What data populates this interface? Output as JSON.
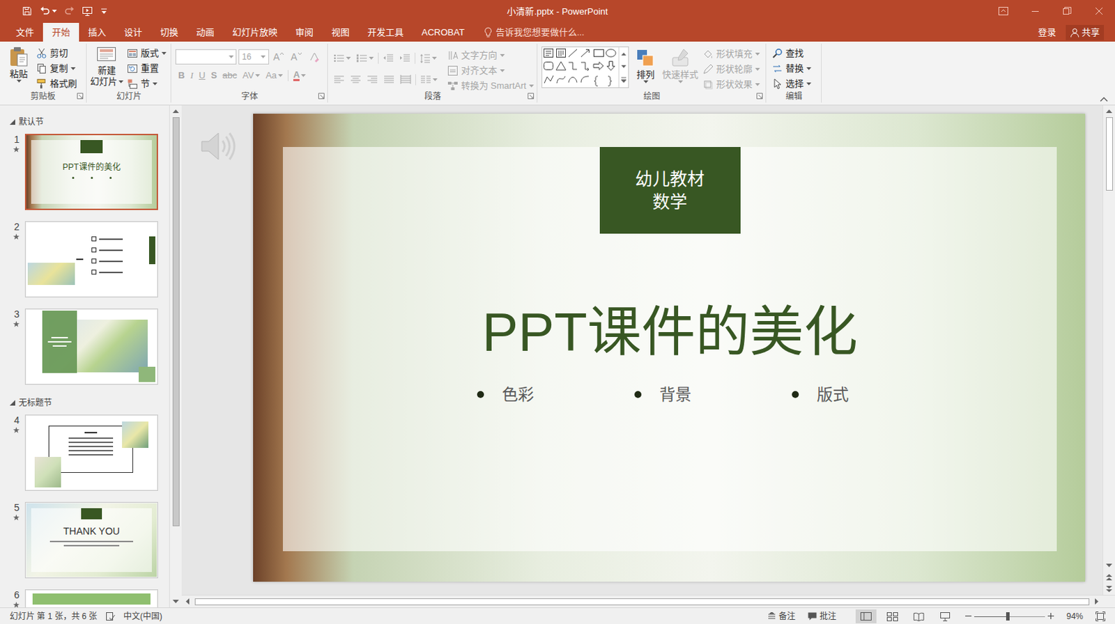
{
  "window": {
    "title": "小清新.pptx - PowerPoint"
  },
  "quick_access": [
    {
      "kind": "save",
      "disabled": false
    },
    {
      "kind": "undo",
      "disabled": false
    },
    {
      "kind": "redo",
      "disabled": true
    },
    {
      "kind": "slideshow",
      "disabled": false
    },
    {
      "kind": "customize",
      "disabled": false
    }
  ],
  "ribbon_tabs": [
    {
      "label": "文件",
      "selected": false
    },
    {
      "label": "开始",
      "selected": true
    },
    {
      "label": "插入",
      "selected": false
    },
    {
      "label": "设计",
      "selected": false
    },
    {
      "label": "切换",
      "selected": false
    },
    {
      "label": "动画",
      "selected": false
    },
    {
      "label": "幻灯片放映",
      "selected": false
    },
    {
      "label": "审阅",
      "selected": false
    },
    {
      "label": "视图",
      "selected": false
    },
    {
      "label": "开发工具",
      "selected": false
    },
    {
      "label": "ACROBAT",
      "selected": false
    }
  ],
  "tell_me": {
    "placeholder": "告诉我您想要做什么..."
  },
  "account": {
    "sign_in": "登录",
    "share": "共享"
  },
  "ribbon": {
    "clipboard": {
      "label": "剪贴板",
      "paste": "粘贴",
      "cut": "剪切",
      "copy": "复制",
      "format_painter": "格式刷"
    },
    "slides": {
      "label": "幻灯片",
      "new_slide": [
        "新建",
        "幻灯片"
      ],
      "layout": "版式",
      "reset": "重置",
      "section": "节"
    },
    "font": {
      "label": "字体",
      "size": "16",
      "disabled": true,
      "size_buttons": [
        {
          "label": "A",
          "kind": "grow"
        },
        {
          "label": "A",
          "kind": "shrink"
        }
      ],
      "format_buttons": [
        {
          "label": "B",
          "kind": "bold"
        },
        {
          "label": "I",
          "kind": "italic"
        },
        {
          "label": "U",
          "kind": "underline"
        },
        {
          "label": "S",
          "kind": "shadow"
        },
        {
          "label": "abc",
          "kind": "strike"
        },
        {
          "label": "AV",
          "kind": "spacing"
        },
        {
          "label": "Aa",
          "kind": "case"
        },
        {
          "label": "A",
          "kind": "color"
        }
      ]
    },
    "paragraph": {
      "label": "段落",
      "disabled": true,
      "text_direction": "文字方向",
      "align_text": "对齐文本",
      "smartart": "转换为 SmartArt"
    },
    "drawing": {
      "label": "绘图",
      "arrange": "排列",
      "quick_styles": "快速样式",
      "quick_styles_disabled": true,
      "shape_fill": "形状填充",
      "shape_outline": "形状轮廓",
      "shape_effects": "形状效果",
      "shape_format_disabled": true
    },
    "editing": {
      "label": "编辑",
      "find": "查找",
      "replace": "替换",
      "select": "选择"
    }
  },
  "thumbnails": {
    "sections": [
      {
        "title": "默认节",
        "expanded": true,
        "slides": [
          {
            "number": "1",
            "selected": true,
            "animated": true,
            "kind": "title",
            "texts": [
              "PPT课件的美化"
            ]
          },
          {
            "number": "2",
            "selected": false,
            "animated": true,
            "kind": "toc",
            "texts": []
          },
          {
            "number": "3",
            "selected": false,
            "animated": true,
            "kind": "photo",
            "texts": []
          }
        ]
      },
      {
        "title": "无标题节",
        "expanded": true,
        "slides": [
          {
            "number": "4",
            "selected": false,
            "animated": true,
            "kind": "text",
            "texts": []
          },
          {
            "number": "5",
            "selected": false,
            "animated": true,
            "kind": "thanks",
            "texts": [
              "THANK YOU"
            ]
          },
          {
            "number": "6",
            "selected": false,
            "animated": true,
            "kind": "banner",
            "texts": []
          }
        ]
      }
    ]
  },
  "slide": {
    "has_audio": true,
    "badge": [
      "幼儿教材",
      "数学"
    ],
    "title": "PPT课件的美化",
    "bullets": [
      "色彩",
      "背景",
      "版式"
    ]
  },
  "status_bar": {
    "slide_info": "幻灯片 第 1 张，共 6 张",
    "language": "中文(中国)",
    "notes": "备注",
    "comments": "批注",
    "views": [
      {
        "kind": "normal",
        "selected": true
      },
      {
        "kind": "sorter",
        "selected": false
      },
      {
        "kind": "reading",
        "selected": false
      },
      {
        "kind": "slideshow",
        "selected": false
      }
    ],
    "zoom": "94%",
    "zoom_level": 0.47
  }
}
